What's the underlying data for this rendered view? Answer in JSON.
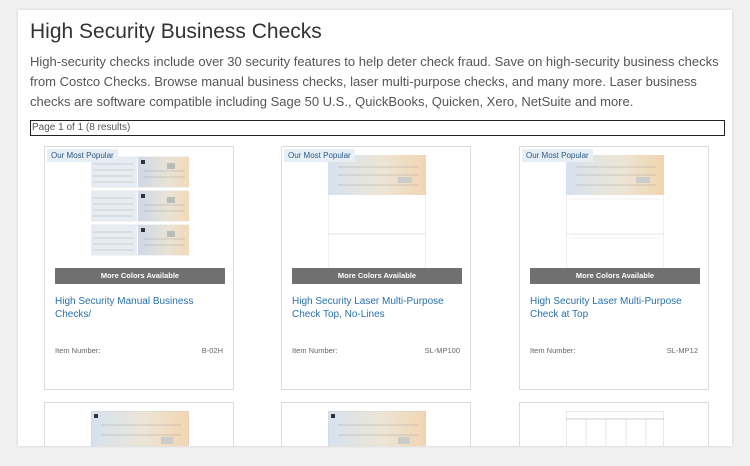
{
  "page": {
    "title": "High Security Business Checks",
    "description": "High-security checks include over 30 security features to help deter check fraud. Save on high-security business checks from Costco Checks. Browse manual business checks, laser multi-purpose checks, and many more. Laser business checks are software compatible including Sage 50 U.S., QuickBooks, Quicken, Xero, NetSuite and more.",
    "pager": "Page 1 of 1 (8 results)"
  },
  "products": [
    {
      "badge": "Our Most Popular",
      "colors_label": "More Colors Available",
      "name": "High Security Manual Business Checks/",
      "item_label": "Item Number:",
      "item_number": "B-02H",
      "thumbnail": "manual-3-per-page"
    },
    {
      "badge": "Our Most Popular",
      "colors_label": "More Colors Available",
      "name": "High Security Laser Multi-Purpose Check Top, No-Lines",
      "item_label": "Item Number:",
      "item_number": "SL-MP100",
      "thumbnail": "laser-top-no-lines"
    },
    {
      "badge": "Our Most Popular",
      "colors_label": "More Colors Available",
      "name": "High Security Laser Multi-Purpose Check at Top",
      "item_label": "Item Number:",
      "item_number": "SL-MP12",
      "thumbnail": "laser-top-lines"
    }
  ],
  "second_row": [
    {
      "thumbnail": "laser-check"
    },
    {
      "thumbnail": "laser-check"
    },
    {
      "thumbnail": "voucher-table"
    }
  ],
  "colors": {
    "link": "#2770b6",
    "badge_bg": "#e6eef6",
    "bar": "#707070"
  }
}
